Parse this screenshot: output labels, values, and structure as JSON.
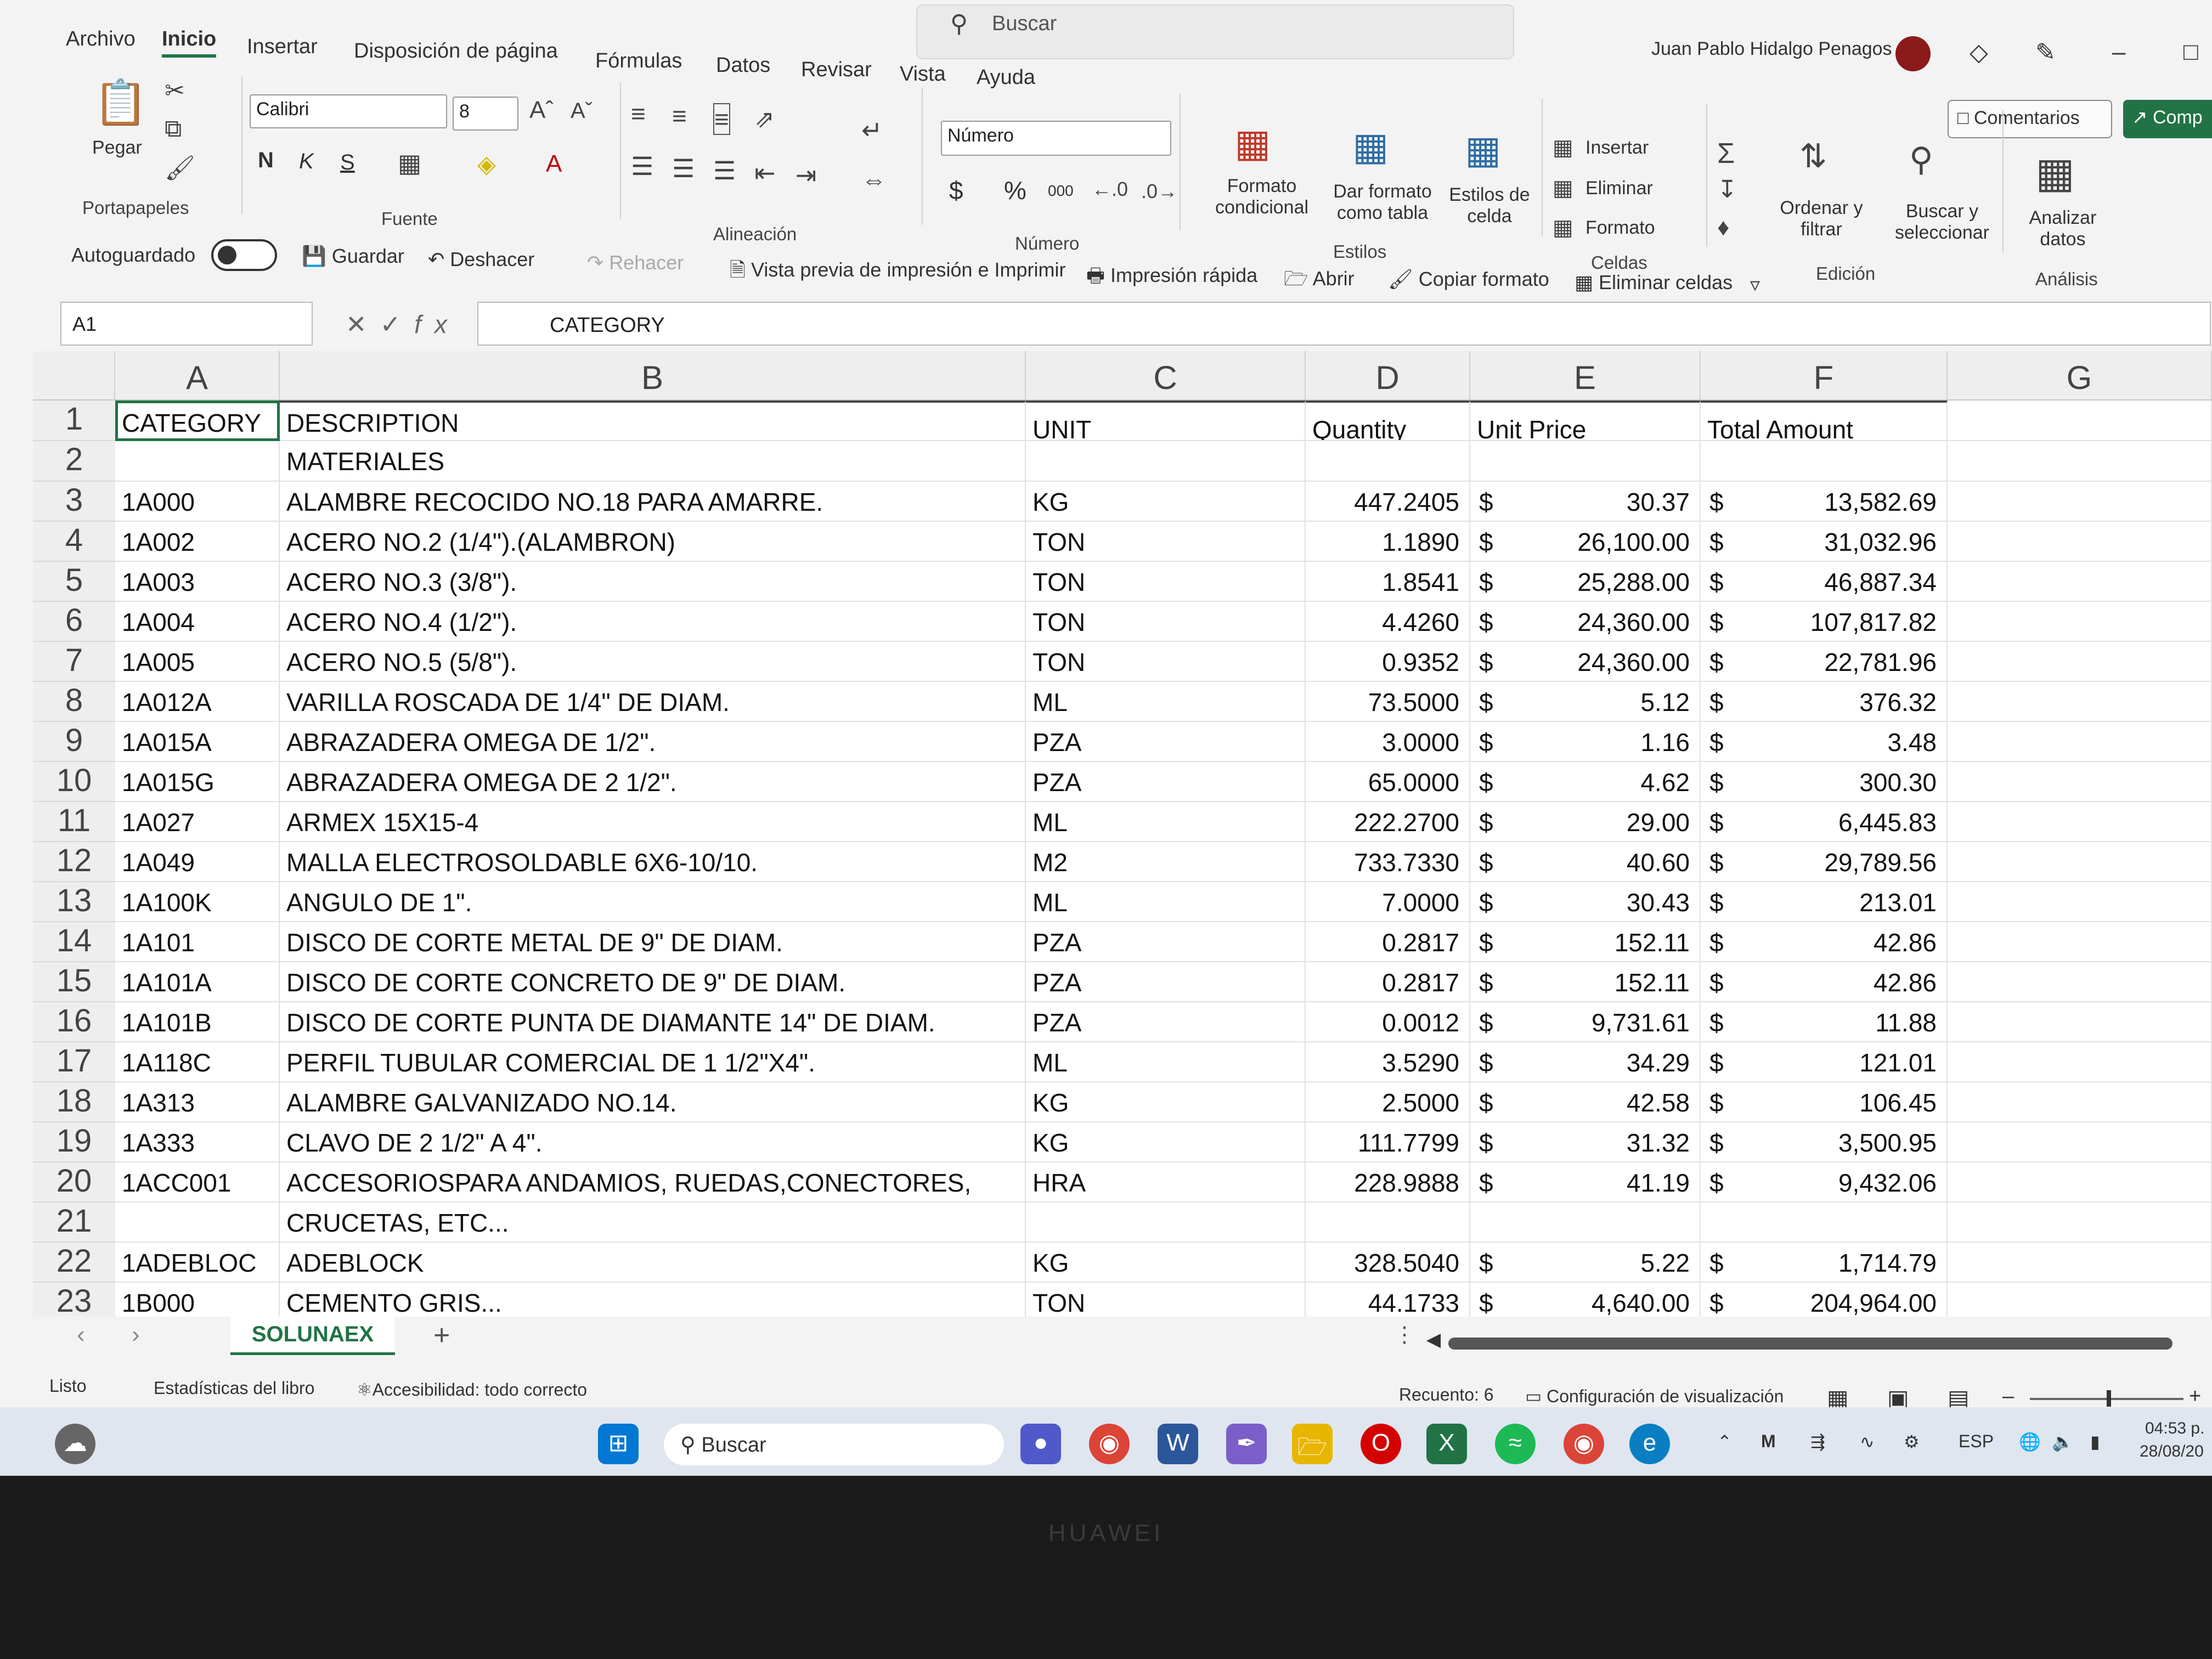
{
  "search": {
    "placeholder": "Buscar"
  },
  "menu": [
    "Archivo",
    "Inicio",
    "Insertar",
    "Disposición de página",
    "Fórmulas",
    "Datos",
    "Revisar",
    "Vista",
    "Ayuda"
  ],
  "user": {
    "name": "Juan Pablo Hidalgo Penagos"
  },
  "buttons": {
    "comments": "Comentarios",
    "share": "Comp"
  },
  "ribbon": {
    "paste": "Pegar",
    "clipboard_group": "Portapapeles",
    "font_name": "Calibri",
    "font_size": "8",
    "bold": "N",
    "italic": "K",
    "underline": "S",
    "font_group": "Fuente",
    "alignment_group": "Alineación",
    "number_format": "Número",
    "number_group": "Número",
    "currency": "$",
    "percent": "%",
    "thousands": "000",
    "cond_format": "Formato condicional",
    "table_format": "Dar formato como tabla",
    "cell_styles": "Estilos de celda",
    "styles_group": "Estilos",
    "insert": "Insertar",
    "delete": "Eliminar",
    "format": "Formato",
    "cells_group": "Celdas",
    "sort_filter": "Ordenar y filtrar",
    "find_select": "Buscar y seleccionar",
    "editing_group": "Edición",
    "analyze": "Analizar datos",
    "analysis_group": "Análisis"
  },
  "qat": {
    "autosave": "Autoguardado",
    "save": "Guardar",
    "undo": "Deshacer",
    "redo": "Rehacer",
    "print_preview": "Vista previa de impresión e Imprimir",
    "quick_print": "Impresión rápida",
    "open": "Abrir",
    "copy_format": "Copiar formato",
    "delete_cells": "Eliminar celdas"
  },
  "formula_bar": {
    "name_box": "A1",
    "fx": "fx",
    "value": "CATEGORY"
  },
  "columns": [
    "A",
    "B",
    "C",
    "D",
    "E",
    "F",
    "G"
  ],
  "header_row": {
    "category": "CATEGORY",
    "description": "DESCRIPTION",
    "unit": "UNIT",
    "quantity": "Quantity",
    "unit_price": "Unit Price",
    "total": "Total Amount"
  },
  "row2": {
    "description": "MATERIALES"
  },
  "rows": [
    {
      "n": "3",
      "cat": "1A000",
      "desc": "ALAMBRE RECOCIDO NO.18 PARA AMARRE.",
      "unit": "KG",
      "qty": "447.2405",
      "price": "30.37",
      "total": "13,582.69"
    },
    {
      "n": "4",
      "cat": "1A002",
      "desc": "ACERO NO.2 (1/4\").(ALAMBRON)",
      "unit": "TON",
      "qty": "1.1890",
      "price": "26,100.00",
      "total": "31,032.96"
    },
    {
      "n": "5",
      "cat": "1A003",
      "desc": "ACERO NO.3 (3/8\").",
      "unit": "TON",
      "qty": "1.8541",
      "price": "25,288.00",
      "total": "46,887.34"
    },
    {
      "n": "6",
      "cat": "1A004",
      "desc": "ACERO NO.4 (1/2\").",
      "unit": "TON",
      "qty": "4.4260",
      "price": "24,360.00",
      "total": "107,817.82"
    },
    {
      "n": "7",
      "cat": "1A005",
      "desc": "ACERO NO.5 (5/8\").",
      "unit": "TON",
      "qty": "0.9352",
      "price": "24,360.00",
      "total": "22,781.96"
    },
    {
      "n": "8",
      "cat": "1A012A",
      "desc": "VARILLA ROSCADA DE 1/4\" DE DIAM.",
      "unit": "ML",
      "qty": "73.5000",
      "price": "5.12",
      "total": "376.32"
    },
    {
      "n": "9",
      "cat": "1A015A",
      "desc": "ABRAZADERA OMEGA DE 1/2\".",
      "unit": "PZA",
      "qty": "3.0000",
      "price": "1.16",
      "total": "3.48"
    },
    {
      "n": "10",
      "cat": "1A015G",
      "desc": "ABRAZADERA OMEGA DE 2 1/2\".",
      "unit": "PZA",
      "qty": "65.0000",
      "price": "4.62",
      "total": "300.30"
    },
    {
      "n": "11",
      "cat": "1A027",
      "desc": "ARMEX 15X15-4",
      "unit": "ML",
      "qty": "222.2700",
      "price": "29.00",
      "total": "6,445.83"
    },
    {
      "n": "12",
      "cat": "1A049",
      "desc": "MALLA ELECTROSOLDABLE 6X6-10/10.",
      "unit": "M2",
      "qty": "733.7330",
      "price": "40.60",
      "total": "29,789.56"
    },
    {
      "n": "13",
      "cat": "1A100K",
      "desc": "ANGULO DE 1\".",
      "unit": "ML",
      "qty": "7.0000",
      "price": "30.43",
      "total": "213.01"
    },
    {
      "n": "14",
      "cat": "1A101",
      "desc": "DISCO DE CORTE METAL DE 9\" DE DIAM.",
      "unit": "PZA",
      "qty": "0.2817",
      "price": "152.11",
      "total": "42.86"
    },
    {
      "n": "15",
      "cat": "1A101A",
      "desc": "DISCO DE CORTE CONCRETO DE 9\" DE DIAM.",
      "unit": "PZA",
      "qty": "0.2817",
      "price": "152.11",
      "total": "42.86"
    },
    {
      "n": "16",
      "cat": "1A101B",
      "desc": "DISCO DE CORTE PUNTA DE DIAMANTE 14\" DE DIAM.",
      "unit": "PZA",
      "qty": "0.0012",
      "price": "9,731.61",
      "total": "11.88"
    },
    {
      "n": "17",
      "cat": "1A118C",
      "desc": "PERFIL TUBULAR COMERCIAL DE 1 1/2\"X4\".",
      "unit": "ML",
      "qty": "3.5290",
      "price": "34.29",
      "total": "121.01"
    },
    {
      "n": "18",
      "cat": "1A313",
      "desc": "ALAMBRE GALVANIZADO NO.14.",
      "unit": "KG",
      "qty": "2.5000",
      "price": "42.58",
      "total": "106.45"
    },
    {
      "n": "19",
      "cat": "1A333",
      "desc": "CLAVO DE 2 1/2\" A 4\".",
      "unit": "KG",
      "qty": "111.7799",
      "price": "31.32",
      "total": "3,500.95"
    },
    {
      "n": "20",
      "cat": "1ACC001",
      "desc": "ACCESORIOSPARA ANDAMIOS, RUEDAS,CONECTORES,",
      "unit": "HRA",
      "qty": "228.9888",
      "price": "41.19",
      "total": "9,432.06"
    },
    {
      "n": "21",
      "cat": "",
      "desc": "CRUCETAS, ETC...",
      "unit": "",
      "qty": "",
      "price": "",
      "total": ""
    },
    {
      "n": "22",
      "cat": "1ADEBLOC",
      "desc": "ADEBLOCK",
      "unit": "KG",
      "qty": "328.5040",
      "price": "5.22",
      "total": "1,714.79"
    },
    {
      "n": "23",
      "cat": "1B000",
      "desc": "CEMENTO GRIS...",
      "unit": "TON",
      "qty": "44.1733",
      "price": "4,640.00",
      "total": "204,964.00"
    }
  ],
  "currency_symbol": "$",
  "sheet": {
    "tab": "SOLUNAEX",
    "add": "+"
  },
  "status": {
    "ready": "Listo",
    "stats": "Estadísticas del libro",
    "accessibility": "Accesibilidad: todo correcto",
    "count": "Recuento: 6",
    "display": "Configuración de visualización"
  },
  "taskbar": {
    "search": "Buscar",
    "lang": "ESP",
    "time": "04:53 p.",
    "date": "28/08/20"
  },
  "brand": "HUAWEI",
  "colors": {
    "accent": "#217346"
  }
}
